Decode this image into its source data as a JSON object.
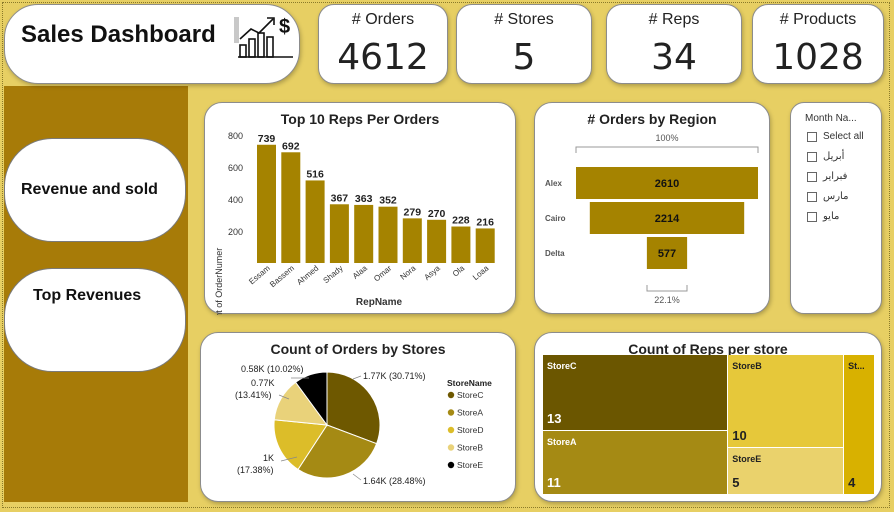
{
  "header": {
    "title": "Sales Dashboard",
    "icon": "chart-dollar-icon"
  },
  "kpis": [
    {
      "label": "# Orders",
      "value": "4612"
    },
    {
      "label": "# Stores",
      "value": "5"
    },
    {
      "label": "# Reps",
      "value": "34"
    },
    {
      "label": "# Products",
      "value": "1028"
    }
  ],
  "nav": {
    "revenue_sold": "Revenue and sold",
    "top_revenues": "Top Revenues"
  },
  "colors": {
    "page_bg": "#e7cf63",
    "sidebar": "#a77b08",
    "bar": "#a58300"
  },
  "bar_chart": {
    "title": "Top 10 Reps Per Orders",
    "xlabel": "RepName",
    "ylabel": "Count of OrderNumer",
    "yticks": [
      "800",
      "600",
      "400",
      "200"
    ]
  },
  "funnel": {
    "title": "# Orders by Region",
    "top_pct": "100%",
    "bottom_pct": "22.1%"
  },
  "slicer": {
    "title": "Month Na...",
    "items": [
      "Select all",
      "أبريل",
      "فبراير",
      "مارس",
      "مايو"
    ]
  },
  "pie": {
    "title": "Count of Orders by Stores",
    "legend_title": "StoreName",
    "labels": {
      "storeC": "1.77K (30.71%)",
      "storeA": "1.64K (28.48%)",
      "storeD_1": "1K",
      "storeD_2": "(17.38%)",
      "storeB_1": "0.77K",
      "storeB_2": "(13.41%)",
      "storeE": "0.58K (10.02%)"
    }
  },
  "treemap": {
    "title": "Count of Reps per store"
  },
  "chart_data": [
    {
      "type": "bar",
      "title": "Top 10 Reps Per Orders",
      "xlabel": "RepName",
      "ylabel": "Count of OrderNumer",
      "categories": [
        "Essam",
        "Bassem",
        "Ahmed",
        "Shady",
        "Alaa",
        "Omar",
        "Nora",
        "Asya",
        "Ola",
        "Loaa"
      ],
      "values": [
        739,
        692,
        516,
        367,
        363,
        352,
        279,
        270,
        228,
        216
      ],
      "ylim": [
        0,
        800
      ],
      "color": "#a58300"
    },
    {
      "type": "bar",
      "subtype": "funnel",
      "title": "# Orders by Region",
      "categories": [
        "Alex",
        "Cairo",
        "Delta"
      ],
      "values": [
        2610,
        2214,
        577
      ],
      "color": "#a58300"
    },
    {
      "type": "pie",
      "title": "Count of Orders by Stores",
      "legend_title": "StoreName",
      "categories": [
        "StoreC",
        "StoreA",
        "StoreD",
        "StoreB",
        "StoreE"
      ],
      "values": [
        1770,
        1640,
        1000,
        770,
        580
      ],
      "percents": [
        30.71,
        28.48,
        17.38,
        13.41,
        10.02
      ],
      "colors": [
        "#6e5800",
        "#a58a14",
        "#dcbd29",
        "#e9d27a",
        "#000000"
      ]
    },
    {
      "type": "treemap",
      "title": "Count of Reps per store",
      "categories": [
        "StoreC",
        "StoreA",
        "StoreB",
        "StoreE",
        "St..."
      ],
      "values": [
        13,
        11,
        10,
        5,
        4
      ],
      "colors": [
        "#6b5600",
        "#a58a14",
        "#e6c83a",
        "#ead26c",
        "#d8b100"
      ]
    }
  ]
}
